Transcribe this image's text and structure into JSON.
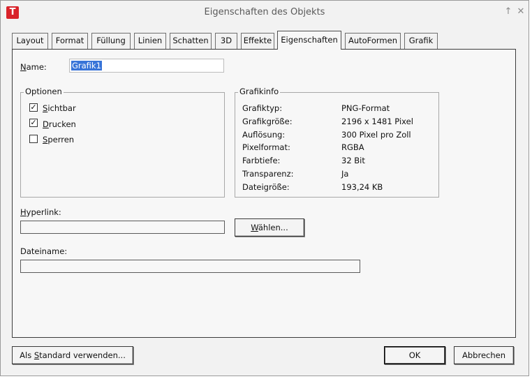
{
  "window": {
    "title": "Eigenschaften des Objekts",
    "app_icon_letter": "T",
    "pin_glyph": "↑",
    "close_glyph": "✕"
  },
  "tabs": [
    {
      "label": "Layout"
    },
    {
      "label": "Format"
    },
    {
      "label": "Füllung"
    },
    {
      "label": "Linien"
    },
    {
      "label": "Schatten"
    },
    {
      "label": "3D"
    },
    {
      "label": "Effekte"
    },
    {
      "label": "Eigenschaften",
      "active": true
    },
    {
      "label": "AutoFormen"
    },
    {
      "label": "Grafik"
    }
  ],
  "name_field": {
    "label_first": "N",
    "label_rest": "ame:",
    "value": "Grafik1"
  },
  "optionen": {
    "title": "Optionen",
    "items": [
      {
        "mnemonic": "S",
        "rest": "ichtbar",
        "checked": true,
        "mark": "✓"
      },
      {
        "mnemonic": "D",
        "rest": "rucken",
        "checked": true,
        "mark": "✓"
      },
      {
        "mnemonic": "S",
        "rest": "perren",
        "checked": false,
        "mark": ""
      }
    ]
  },
  "grafikinfo": {
    "title": "Grafikinfo",
    "rows": [
      {
        "label": "Grafiktyp:",
        "value": "PNG-Format"
      },
      {
        "label": "Grafikgröße:",
        "value": "2196 x 1481 Pixel"
      },
      {
        "label": "Auflösung:",
        "value": "300 Pixel pro Zoll"
      },
      {
        "label": "Pixelformat:",
        "value": "RGBA"
      },
      {
        "label": "Farbtiefe:",
        "value": "32 Bit"
      },
      {
        "label": "Transparenz:",
        "value": "Ja"
      },
      {
        "label": "Dateigröße:",
        "value": "193,24 KB"
      }
    ]
  },
  "hyperlink": {
    "label_first": "H",
    "label_rest": "yperlink:",
    "value": ""
  },
  "waehlen_button": {
    "label_first": "W",
    "label_rest": "ählen..."
  },
  "dateiname": {
    "label": "Dateiname:",
    "value": ""
  },
  "footer": {
    "standard_pre": "Als ",
    "standard_mn": "S",
    "standard_rest": "tandard verwenden...",
    "ok": "OK",
    "cancel": "Abbrechen"
  }
}
